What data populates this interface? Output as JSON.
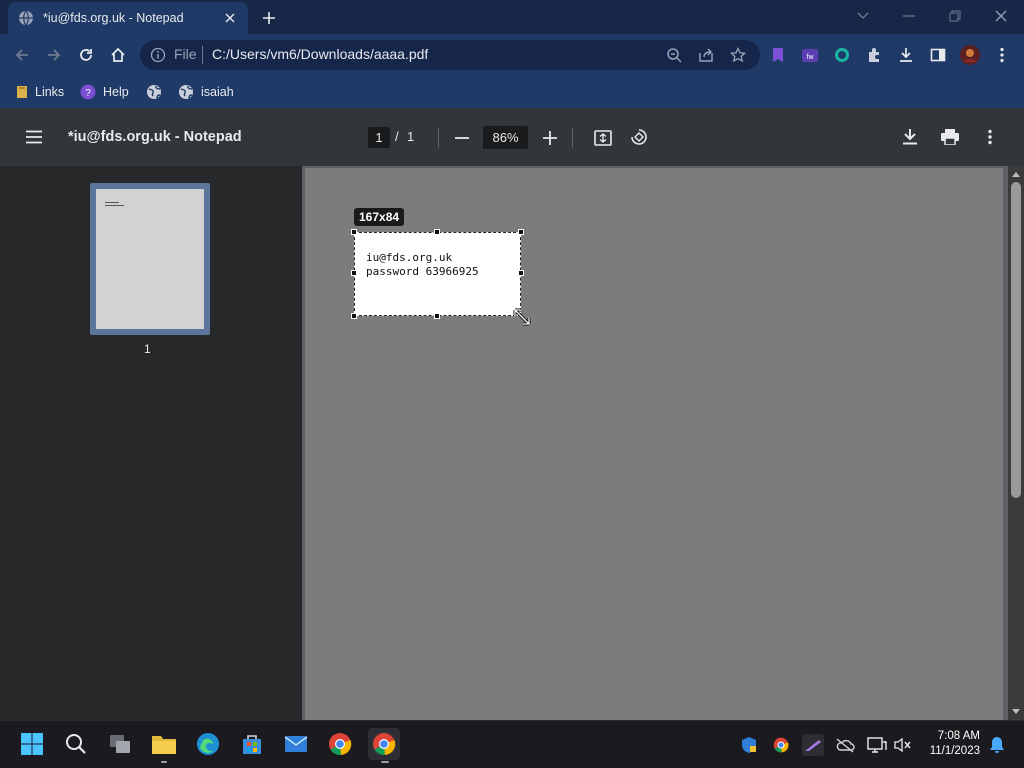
{
  "browser": {
    "tab": {
      "title": "*iu@fds.org.uk - Notepad",
      "icon": "globe-icon"
    },
    "address": {
      "scheme_label": "File",
      "url": "C:/Users/vm6/Downloads/aaaa.pdf"
    },
    "bookmarks": [
      {
        "label": "Links",
        "icon": "bookmark-folder-icon"
      },
      {
        "label": "Help",
        "icon": "help-icon"
      },
      {
        "label": "",
        "icon": "globe-icon"
      },
      {
        "label": "isaiah",
        "icon": "globe-icon"
      }
    ],
    "colors": {
      "chrome_bg": "#1f3a66",
      "titlebar_bg": "#162748"
    }
  },
  "pdf_viewer": {
    "title": "*iu@fds.org.uk - Notepad",
    "current_page": "1",
    "page_separator": "/",
    "total_pages": "1",
    "zoom": "86%",
    "thumbnail_label": "1"
  },
  "snip": {
    "size_label": "167x84",
    "lines": [
      "iu@fds.org.uk",
      "password 63966925"
    ]
  },
  "taskbar": {
    "time": "7:08 AM",
    "date": "11/1/2023",
    "apps": [
      "start-icon",
      "search-icon",
      "task-view-icon",
      "file-explorer-icon",
      "edge-icon",
      "store-icon",
      "mail-icon",
      "chrome-icon",
      "chrome-icon"
    ]
  }
}
